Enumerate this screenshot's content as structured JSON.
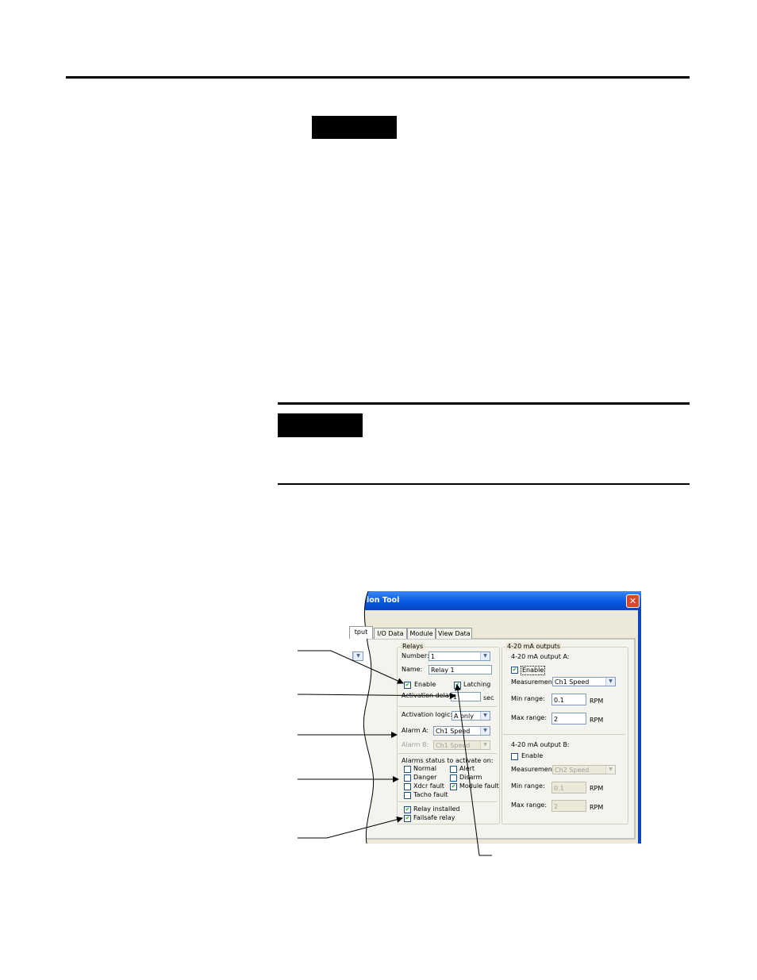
{
  "dialog": {
    "title_fragment": "ion Tool",
    "tabs": [
      "tput",
      "I/O Data",
      "Module",
      "View Data"
    ],
    "relays": {
      "group_label": "Relays",
      "number_label": "Number:",
      "number_value": "1",
      "name_label": "Name:",
      "name_value": "Relay 1",
      "enable_label": "Enable",
      "latching_label": "Latching",
      "activation_delay_label": "Activation delay:",
      "activation_delay_value": "1",
      "delay_unit": "sec",
      "activation_logic_label": "Activation logic:",
      "activation_logic_value": "A only",
      "alarm_a_label": "Alarm A:",
      "alarm_a_value": "Ch1 Speed",
      "alarm_b_label": "Alarm B:",
      "alarm_b_value": "Ch1 Speed",
      "alarm_status_label": "Alarms status to activate on:",
      "status_normal": "Normal",
      "status_alert": "Alert",
      "status_danger": "Danger",
      "status_disarm": "Disarm",
      "status_xdcr_fault": "Xdcr fault",
      "status_module_fault": "Module fault",
      "status_tacho_fault": "Tacho fault",
      "relay_installed_label": "Relay installed",
      "failsafe_relay_label": "Failsafe relay"
    },
    "outputs": {
      "group_label": "4-20 mA outputs",
      "a": {
        "label": "4-20 mA output A:",
        "enable_label": "Enable",
        "measurement_label": "Measurement:",
        "measurement_value": "Ch1 Speed",
        "min_range_label": "Min range:",
        "min_range_value": "0.1",
        "max_range_label": "Max range:",
        "max_range_value": "2",
        "unit": "RPM"
      },
      "b": {
        "label": "4-20 mA output B:",
        "enable_label": "Enable",
        "measurement_label": "Measurement:",
        "measurement_value": "Ch2 Speed",
        "min_range_label": "Min range:",
        "min_range_value": "0.1",
        "max_range_label": "Max range:",
        "max_range_value": "2",
        "unit": "RPM"
      }
    },
    "colors": {
      "titlebar": "#0a5ce6",
      "close_button": "#d8482a",
      "dialog_bg": "#ece9d8"
    },
    "icons": [
      "close-icon",
      "checkmark-icon",
      "dropdown-arrow-icon"
    ]
  }
}
